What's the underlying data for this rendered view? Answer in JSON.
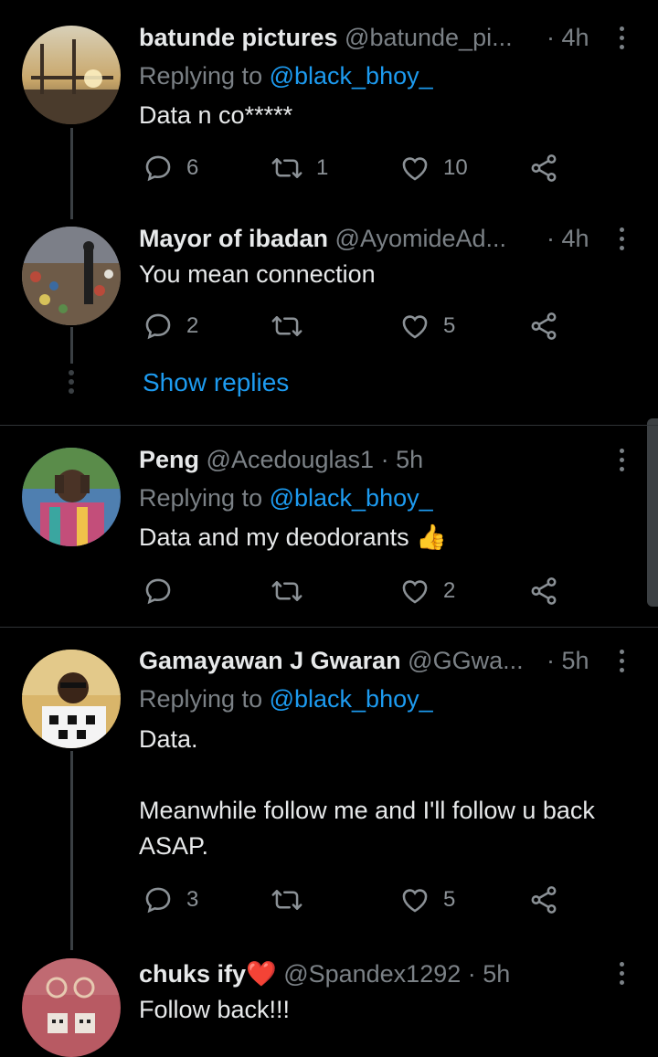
{
  "tweets": [
    {
      "name": "batunde pictures",
      "handle": "@batunde_pi...",
      "time": "· 4h",
      "reply_prefix": "Replying to ",
      "reply_to": "@black_bhoy_",
      "text": "Data n co*****",
      "replies": "6",
      "retweets": "1",
      "likes": "10"
    },
    {
      "name": "Mayor of ibadan",
      "handle": "@AyomideAd...",
      "time": "· 4h",
      "text": "You mean connection",
      "replies": "2",
      "retweets": "",
      "likes": "5"
    },
    {
      "name": "Peng",
      "handle": "@Acedouglas1",
      "time": "· 5h",
      "reply_prefix": "Replying to ",
      "reply_to": "@black_bhoy_",
      "text": "Data and my deodorants 👍",
      "replies": "",
      "retweets": "",
      "likes": "2"
    },
    {
      "name": "Gamayawan J Gwaran",
      "handle": "@GGwa...",
      "time": "· 5h",
      "reply_prefix": "Replying to ",
      "reply_to": "@black_bhoy_",
      "text": "Data.\n\nMeanwhile follow me and I'll follow u back ASAP.",
      "replies": "3",
      "retweets": "",
      "likes": "5"
    },
    {
      "name": "chuks ify",
      "name_emoji": "❤️",
      "handle": "@Spandex1292",
      "time": "· 5h",
      "text": "Follow back!!!"
    }
  ],
  "show_replies": "Show replies",
  "colors": {
    "background": "#000000",
    "text": "#e7e9ea",
    "secondary": "#7b8186",
    "accent": "#1d9bf0",
    "divider": "#2f3336"
  }
}
